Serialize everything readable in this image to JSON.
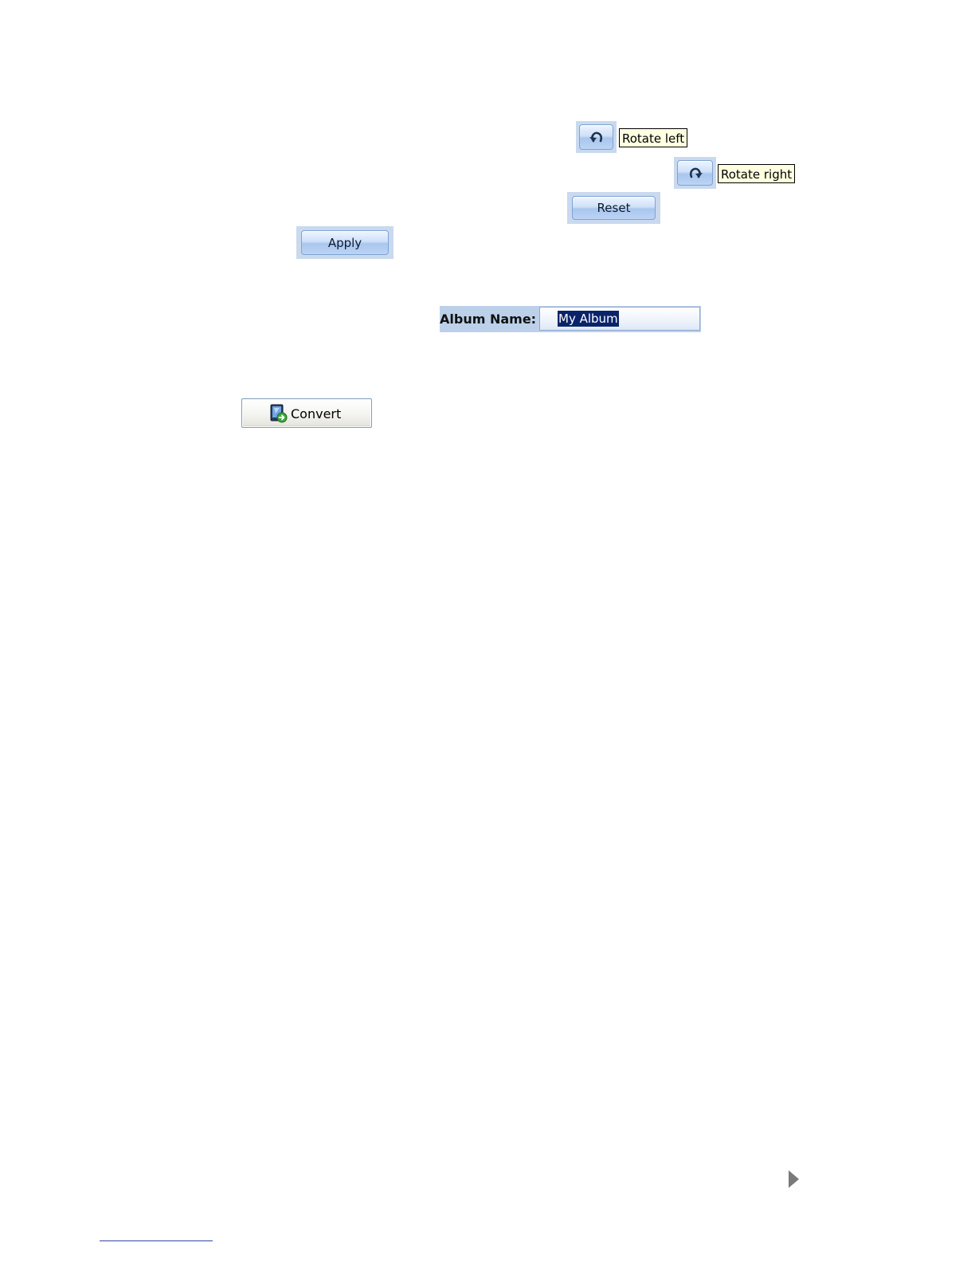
{
  "rotate_left": {
    "icon": "rotate-left-icon",
    "tooltip": "Rotate left"
  },
  "rotate_right": {
    "icon": "rotate-right-icon",
    "tooltip": "Rotate right"
  },
  "reset_button": {
    "label": "Reset"
  },
  "apply_button": {
    "label": "Apply"
  },
  "album": {
    "label": "Album Name:",
    "value": "My Album"
  },
  "convert_button": {
    "icon": "convert-icon",
    "label": "Convert"
  },
  "next_page": {
    "icon": "next-arrow-icon"
  },
  "colors": {
    "button_blue": "#a9c6ee",
    "tooltip_bg": "#ffffe1",
    "selection": "#0a246a"
  }
}
